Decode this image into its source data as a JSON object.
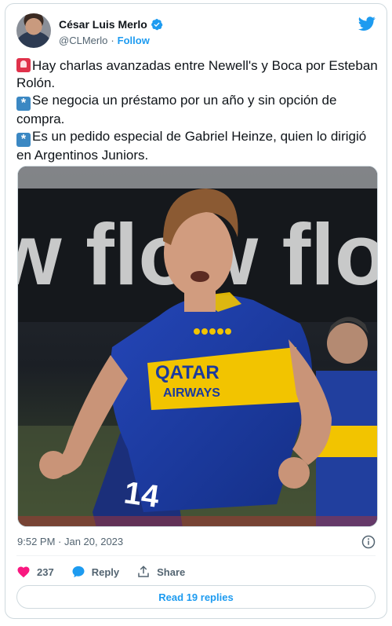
{
  "author": {
    "display_name": "César Luis Merlo",
    "handle": "@CLMerlo",
    "separator": "·",
    "follow_label": "Follow"
  },
  "tweet": {
    "lines": [
      "Hay charlas avanzadas entre Newell's y Boca por Esteban Rolón.",
      "Se negocia un préstamo por un año y sin opción de compra.",
      "Es un pedido especial de Gabriel Heinze, quien lo dirigió en Argentinos Juniors."
    ],
    "line_emojis": [
      "police-light-emoji",
      "asterisk-emoji",
      "asterisk-emoji"
    ],
    "timestamp": "9:52 PM · Jan 20, 2023"
  },
  "photo": {
    "banner_text": "w flow flow",
    "sponsor_line1": "QATAR",
    "sponsor_line2": "AIRWAYS",
    "shirt_number": "14",
    "bg_sponsor": "QATAR AIRWAYS"
  },
  "actions": {
    "like_count": "237",
    "reply_label": "Reply",
    "share_label": "Share",
    "read_replies_label": "Read 19 replies"
  },
  "colors": {
    "accent": "#1d9bf0",
    "like": "#f91880",
    "boca_blue": "#1b3a9e",
    "boca_gold": "#f2c400"
  }
}
